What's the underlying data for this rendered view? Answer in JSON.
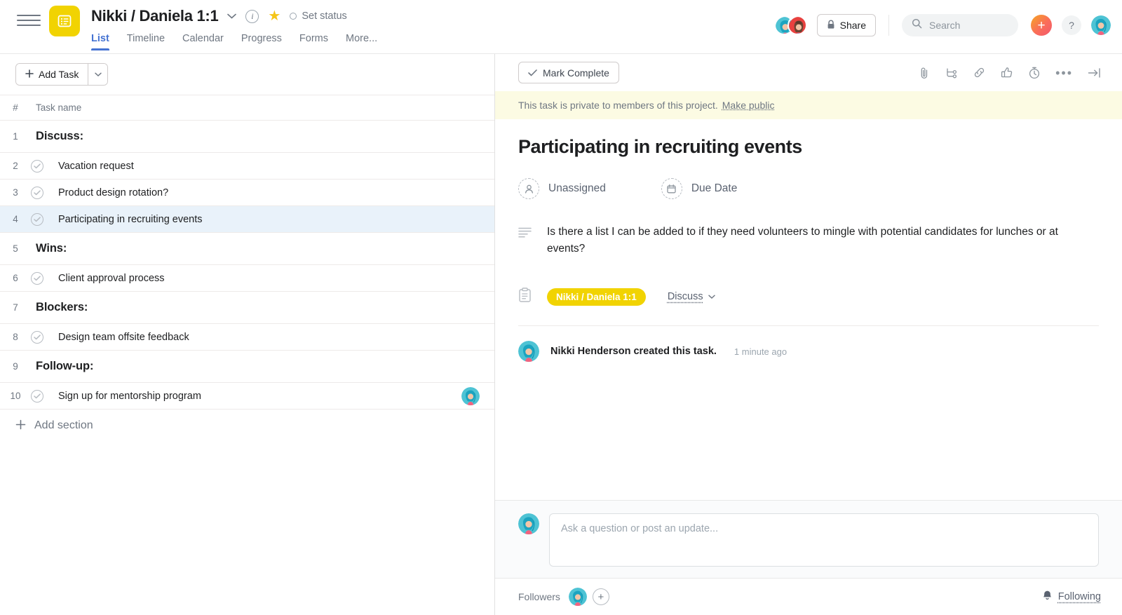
{
  "header": {
    "menu_icon": "hamburger-icon",
    "project_icon": "list-project-icon",
    "project_title": "Nikki / Daniela 1:1",
    "dropdown_icon": "chevron-down-icon",
    "info_icon": "info-icon",
    "star_icon": "star-icon",
    "set_status_label": "Set status",
    "tabs": [
      {
        "label": "List",
        "active": true
      },
      {
        "label": "Timeline",
        "active": false
      },
      {
        "label": "Calendar",
        "active": false
      },
      {
        "label": "Progress",
        "active": false
      },
      {
        "label": "Forms",
        "active": false
      },
      {
        "label": "More...",
        "active": false
      }
    ],
    "share_label": "Share",
    "share_icon": "lock-icon",
    "search": {
      "placeholder": "Search",
      "value": "",
      "icon": "search-icon"
    },
    "plus_label": "+",
    "help_label": "?",
    "member_avatars": [
      {
        "name": "Nikki Henderson",
        "bg": "#4ec3d4",
        "hair": "#1ba4c0",
        "skin": "#f2c6a8"
      },
      {
        "name": "Daniela",
        "bg": "#e8413f",
        "hair": "#6b4433",
        "skin": "#f0c3a4"
      }
    ],
    "me_avatar": {
      "name": "Nikki Henderson",
      "bg": "#4ec3d4",
      "hair": "#1ba4c0",
      "skin": "#f2c6a8"
    }
  },
  "list_pane": {
    "add_task_label": "Add Task",
    "add_task_caret_icon": "chevron-down-icon",
    "columns": {
      "number": "#",
      "task_name": "Task name"
    },
    "rows": [
      {
        "num": "1",
        "title": "Discuss:",
        "type": "section",
        "selected": false,
        "avatar": false
      },
      {
        "num": "2",
        "title": "Vacation request",
        "type": "task",
        "selected": false,
        "avatar": false
      },
      {
        "num": "3",
        "title": "Product design rotation?",
        "type": "task",
        "selected": false,
        "avatar": false
      },
      {
        "num": "4",
        "title": "Participating in recruiting events",
        "type": "task",
        "selected": true,
        "avatar": false
      },
      {
        "num": "5",
        "title": "Wins:",
        "type": "section",
        "selected": false,
        "avatar": false
      },
      {
        "num": "6",
        "title": "Client approval process",
        "type": "task",
        "selected": false,
        "avatar": false
      },
      {
        "num": "7",
        "title": "Blockers:",
        "type": "section",
        "selected": false,
        "avatar": false
      },
      {
        "num": "8",
        "title": "Design team offsite feedback",
        "type": "task",
        "selected": false,
        "avatar": false
      },
      {
        "num": "9",
        "title": "Follow-up:",
        "type": "section",
        "selected": false,
        "avatar": false
      },
      {
        "num": "10",
        "title": "Sign up for mentorship program",
        "type": "task",
        "selected": false,
        "avatar": true
      }
    ],
    "add_section_label": "Add section"
  },
  "detail": {
    "mark_complete_label": "Mark Complete",
    "mark_complete_icon": "check-icon",
    "toolbar_icons": [
      "attachment-icon",
      "subtask-icon",
      "link-icon",
      "like-icon",
      "timer-icon",
      "more-options-icon",
      "collapse-panel-icon"
    ],
    "privacy_text": "This task is private to members of this project.",
    "make_public_label": "Make public",
    "title": "Participating in recruiting events",
    "assignee_label": "Unassigned",
    "assignee_icon": "person-icon",
    "due_date_label": "Due Date",
    "due_date_icon": "calendar-icon",
    "description_icon": "description-icon",
    "description": "Is there a list I can be added to if they need volunteers to mingle with potential candidates for lunches or at events?",
    "projects_icon": "projects-icon",
    "project_chip": "Nikki / Daniela 1:1",
    "project_chip_color": "#f1d302",
    "section_value": "Discuss",
    "section_caret_icon": "chevron-down-icon",
    "story": {
      "author": "Nikki Henderson",
      "text": "Nikki Henderson created this task.",
      "time": "1 minute ago"
    },
    "comment_placeholder": "Ask a question or post an update...",
    "followers_label": "Followers",
    "add_follower_label": "+",
    "following_label": "Following",
    "following_icon": "bell-icon"
  },
  "colors": {
    "accent_blue": "#4573d2",
    "project_yellow": "#f1d302",
    "banner_yellow": "#fcfbe3",
    "selected_row": "#e9f2fa",
    "text_primary": "#1e1f21",
    "text_secondary": "#6f7782",
    "border": "#edeae9"
  }
}
